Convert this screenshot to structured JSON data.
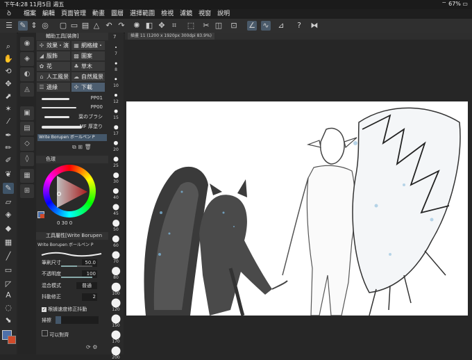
{
  "status": {
    "time": "下午4:28",
    "date": "11月5日 週五",
    "battery": "67%"
  },
  "menu": {
    "items": [
      "檔案",
      "編輯",
      "頁面管理",
      "動畫",
      "圖層",
      "選擇範圍",
      "檢視",
      "濾鏡",
      "視窗",
      "說明"
    ]
  },
  "canvas_tab": {
    "label": "插畫 11 (1200 x 1920px 300dpi 83.9%)"
  },
  "subtool_panel": {
    "title": "輔助工具[裝飾]",
    "groups": [
      {
        "label": "效果・演出"
      },
      {
        "label": "網格線・斷"
      },
      {
        "label": "服飾"
      },
      {
        "label": "圖案"
      },
      {
        "label": "花"
      },
      {
        "label": "草木"
      },
      {
        "label": "人工風景"
      },
      {
        "label": "自然風景"
      },
      {
        "label": "邊緣"
      },
      {
        "label": "下載"
      }
    ],
    "brushes": [
      {
        "name": "PP01"
      },
      {
        "name": "PP00"
      },
      {
        "name": "葉のブラシ"
      },
      {
        "name": "MF 厚塗り"
      }
    ],
    "selected_brush": "Write Borupen ボールペン P"
  },
  "color_panel": {
    "title": "色環",
    "values": "0  30  0",
    "accent": "#d83a3a"
  },
  "props_panel": {
    "title": "工具屬性[Write Borupen",
    "brush_name": "Write Borupen ボールペン P",
    "size_label": "筆刷尺寸",
    "size_value": "50.0",
    "size_fraction": 0.5,
    "opacity_label": "不透明度",
    "opacity_value": "100",
    "opacity_fraction": 1.0,
    "blend_label": "混合模式",
    "blend_value": "普通",
    "stabilize_label": "抖動修正",
    "stabilize_value": "2",
    "speed_label": "根據速度修正抖動",
    "texture_label": "掃擦",
    "last_label": "可以對齊"
  },
  "size_list": [
    "7",
    "8",
    "10",
    "12",
    "15",
    "17",
    "20",
    "25",
    "30",
    "40",
    "45",
    "50",
    "60",
    "70",
    "80",
    "100",
    "120",
    "150",
    "170",
    "200"
  ],
  "panel_tabs_extra": "7"
}
